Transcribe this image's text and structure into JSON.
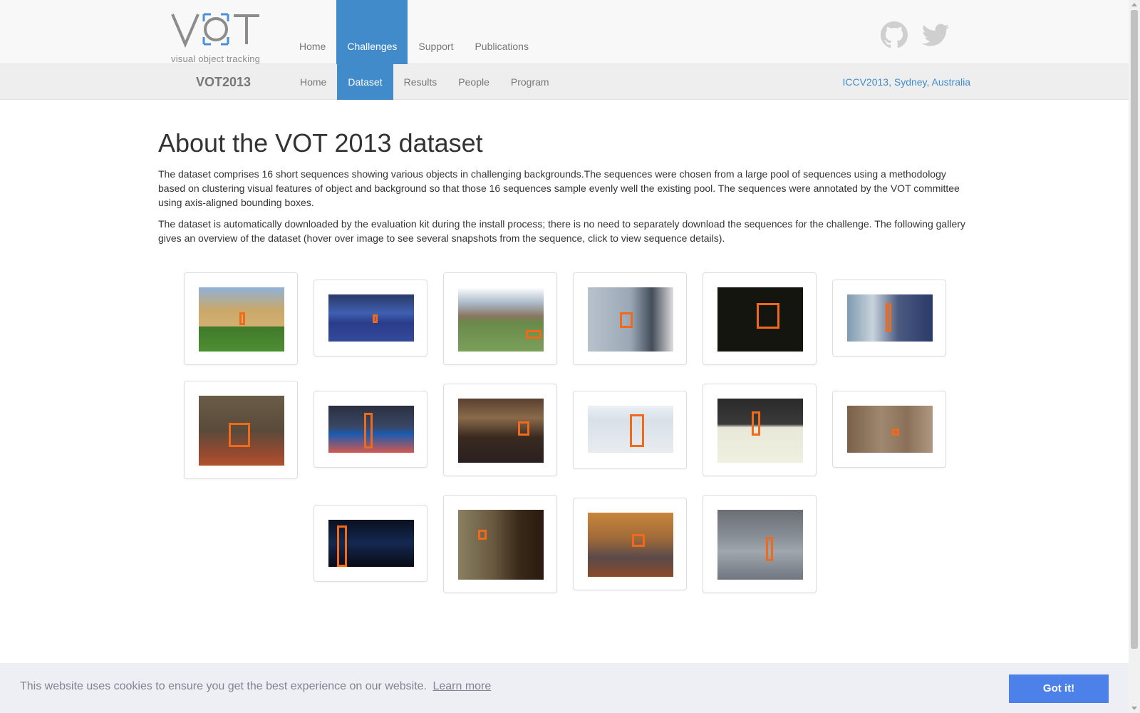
{
  "header": {
    "logo_text": "VOT",
    "logo_subtitle": "visual object tracking",
    "nav": [
      {
        "label": "Home",
        "active": false
      },
      {
        "label": "Challenges",
        "active": true
      },
      {
        "label": "Support",
        "active": false
      },
      {
        "label": "Publications",
        "active": false
      }
    ],
    "social_icons": [
      "github-icon",
      "twitter-icon"
    ]
  },
  "subheader": {
    "brand": "VOT2013",
    "nav": [
      {
        "label": "Home",
        "active": false
      },
      {
        "label": "Dataset",
        "active": true
      },
      {
        "label": "Results",
        "active": false
      },
      {
        "label": "People",
        "active": false
      },
      {
        "label": "Program",
        "active": false
      }
    ],
    "venue_link": "ICCV2013, Sydney, Australia"
  },
  "main": {
    "title": "About the VOT 2013 dataset",
    "paragraphs": [
      "The dataset comprises 16 short sequences showing various objects in challenging backgrounds.The sequences were chosen from a large pool of sequences using a methodology based on clustering visual features of object and background so that those 16 sequences sample evenly well the existing pool. The sequences were annotated by the VOT committee using axis-aligned bounding boxes.",
      "The dataset is automatically downloaded by the evaluation kit during the install process; there is no need to separately download the sequences for the challenge. The following gallery gives an overview of the dataset (hover over image to see several snapshots from the sequence, click to view sequence details)."
    ]
  },
  "gallery": {
    "count": 16,
    "bbox_color": "#f06a1a"
  },
  "cookie_banner": {
    "message": "This website uses cookies to ensure you get the best experience on our website.",
    "learn_more": "Learn more",
    "accept": "Got it!"
  },
  "colors": {
    "accent": "#428bca",
    "cookie_button": "#4b81e8"
  }
}
